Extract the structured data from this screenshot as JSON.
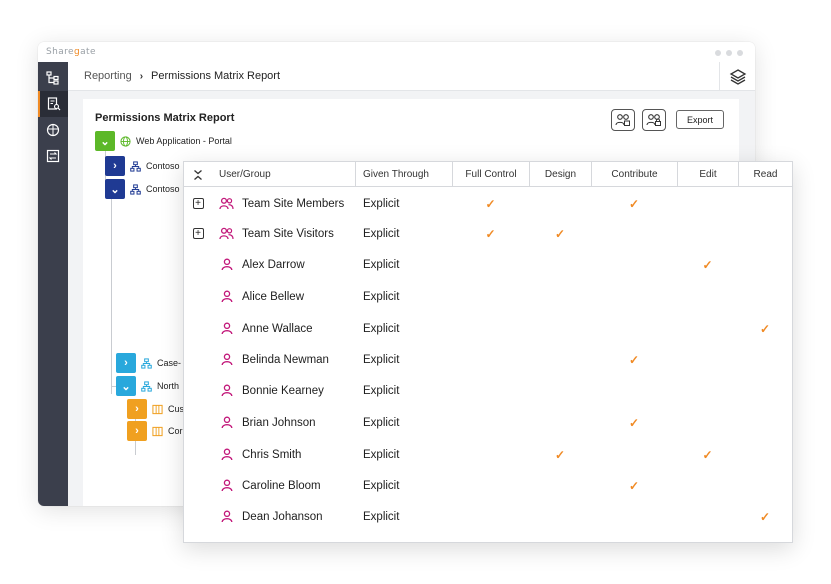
{
  "app": {
    "brand_pre": "Share",
    "brand_g": "g",
    "brand_post": "ate"
  },
  "breadcrumb": {
    "parent": "Reporting",
    "separator": "›",
    "current": "Permissions Matrix Report"
  },
  "panel": {
    "title": "Permissions Matrix Report",
    "export_label": "Export"
  },
  "tree": {
    "root": "Web Application - Portal",
    "nodes": [
      {
        "label": "Contoso",
        "expanded": false
      },
      {
        "label": "Contoso",
        "expanded": true
      },
      {
        "label": "Case-",
        "expanded": false
      },
      {
        "label": "North",
        "expanded": true
      },
      {
        "label": "Cus",
        "expanded": false
      },
      {
        "label": "Cor",
        "expanded": false
      }
    ]
  },
  "matrix": {
    "columns": [
      "User/Group",
      "Given Through",
      "Full Control",
      "Design",
      "Contribute",
      "Edit",
      "Read"
    ],
    "check_glyph": "✓",
    "rows": [
      {
        "name": "Team Site Members",
        "type": "group",
        "given": "Explicit",
        "perms": [
          true,
          false,
          true,
          false,
          false
        ]
      },
      {
        "name": "Team Site Visitors",
        "type": "group",
        "given": "Explicit",
        "perms": [
          true,
          true,
          false,
          false,
          false
        ]
      },
      {
        "name": "Alex Darrow",
        "type": "user",
        "given": "Explicit",
        "perms": [
          false,
          false,
          false,
          true,
          false
        ]
      },
      {
        "name": "Alice Bellew",
        "type": "user",
        "given": "Explicit",
        "perms": [
          false,
          false,
          false,
          false,
          false
        ]
      },
      {
        "name": "Anne Wallace",
        "type": "user",
        "given": "Explicit",
        "perms": [
          false,
          false,
          false,
          false,
          true
        ]
      },
      {
        "name": "Belinda Newman",
        "type": "user",
        "given": "Explicit",
        "perms": [
          false,
          false,
          true,
          false,
          false
        ]
      },
      {
        "name": "Bonnie Kearney",
        "type": "user",
        "given": "Explicit",
        "perms": [
          false,
          false,
          false,
          false,
          false
        ]
      },
      {
        "name": "Brian Johnson",
        "type": "user",
        "given": "Explicit",
        "perms": [
          false,
          false,
          true,
          false,
          false
        ]
      },
      {
        "name": "Chris Smith",
        "type": "user",
        "given": "Explicit",
        "perms": [
          false,
          true,
          false,
          true,
          false
        ]
      },
      {
        "name": "Caroline Bloom",
        "type": "user",
        "given": "Explicit",
        "perms": [
          false,
          false,
          true,
          false,
          false
        ]
      },
      {
        "name": "Dean Johanson",
        "type": "user",
        "given": "Explicit",
        "perms": [
          false,
          false,
          false,
          false,
          true
        ]
      }
    ]
  },
  "colors": {
    "accent": "#f08a24",
    "sidebar": "#3b3f4c",
    "user_icon": "#c2187a",
    "tree_green": "#5cb828",
    "tree_navy": "#1f3a93",
    "tree_cyan": "#29a8dc",
    "tree_orange": "#f0a020"
  }
}
